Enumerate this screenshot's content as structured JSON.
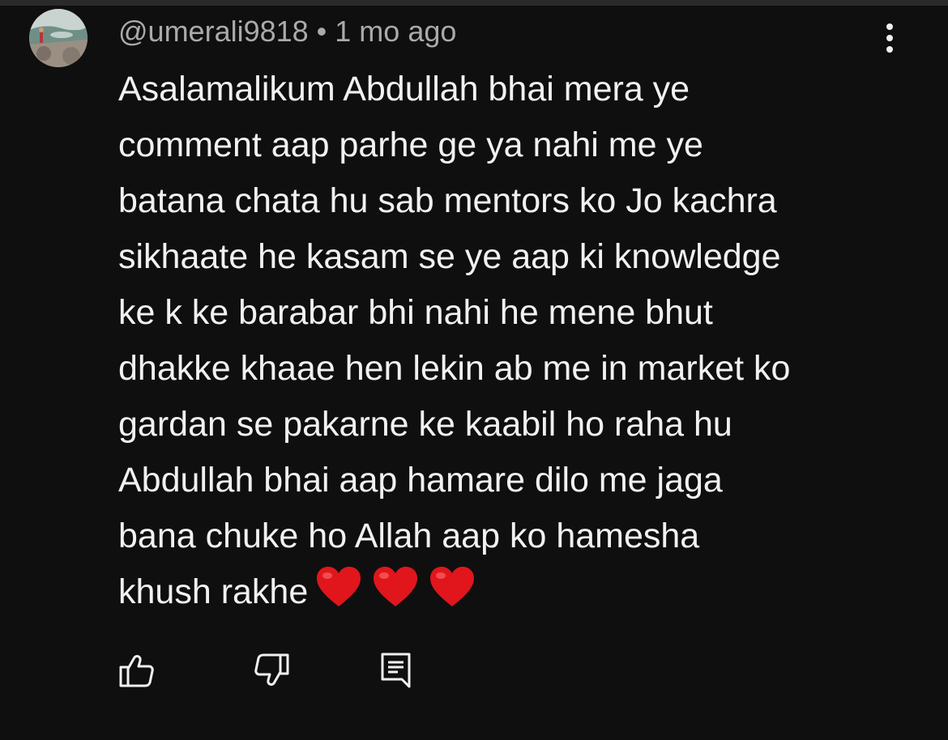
{
  "comment": {
    "author": "@umerali9818",
    "separator": "•",
    "timestamp": "1 mo ago",
    "avatar": "avatar-photo-river-landscape",
    "text": "Asalamalikum Abdullah bhai mera ye\ncomment aap parhe ge ya nahi me ye\nbatana chata hu sab mentors ko Jo kachra\nsikhaate he kasam se ye aap ki knowledge\nke k ke barabar bhi nahi he mene bhut\ndhakke khaae hen lekin ab me in market ko\ngardan se pakarne ke kaabil ho raha hu\nAbdullah bhai aap hamare dilo me jaga\nbana chuke ho Allah aap ko hamesha\nkhush rakhe",
    "emoji": [
      "❤️",
      "❤️",
      "❤️"
    ]
  },
  "actions": {
    "like_icon": "thumbs-up-icon",
    "dislike_icon": "thumbs-down-icon",
    "reply_icon": "reply-comment-icon",
    "more_icon": "vertical-ellipsis-icon"
  },
  "colors": {
    "background": "#0f0f0f",
    "text_primary": "#f1f1f1",
    "text_secondary": "#aaaaaa",
    "heart": "#e0161c"
  }
}
